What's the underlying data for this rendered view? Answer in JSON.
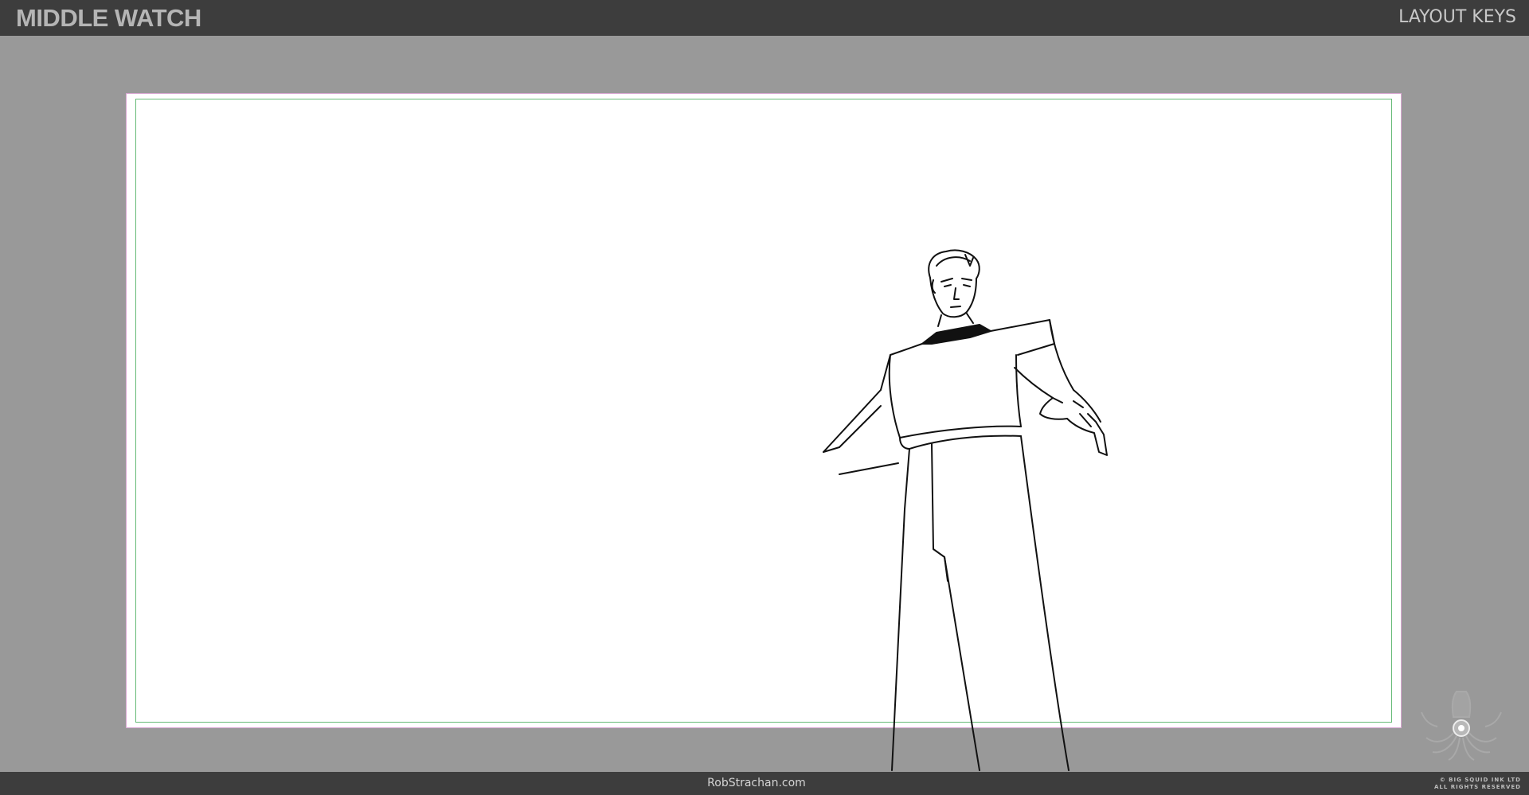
{
  "header": {
    "brand": "MIDDLE WATCH",
    "section": "LAYOUT KEYS"
  },
  "footer": {
    "site": "RobStrachan.com",
    "copyright_line1": "© BIG SQUID INK LTD",
    "copyright_line2": "ALL RIGHTS RESERVED"
  },
  "frame": {
    "border_color": "#d9a7d3",
    "guide_color": "#66bb77"
  },
  "colors": {
    "bar": "#3d3d3d",
    "background": "#999999",
    "paper": "#ffffff"
  },
  "icons": {
    "logo": "squid-logo-icon"
  }
}
